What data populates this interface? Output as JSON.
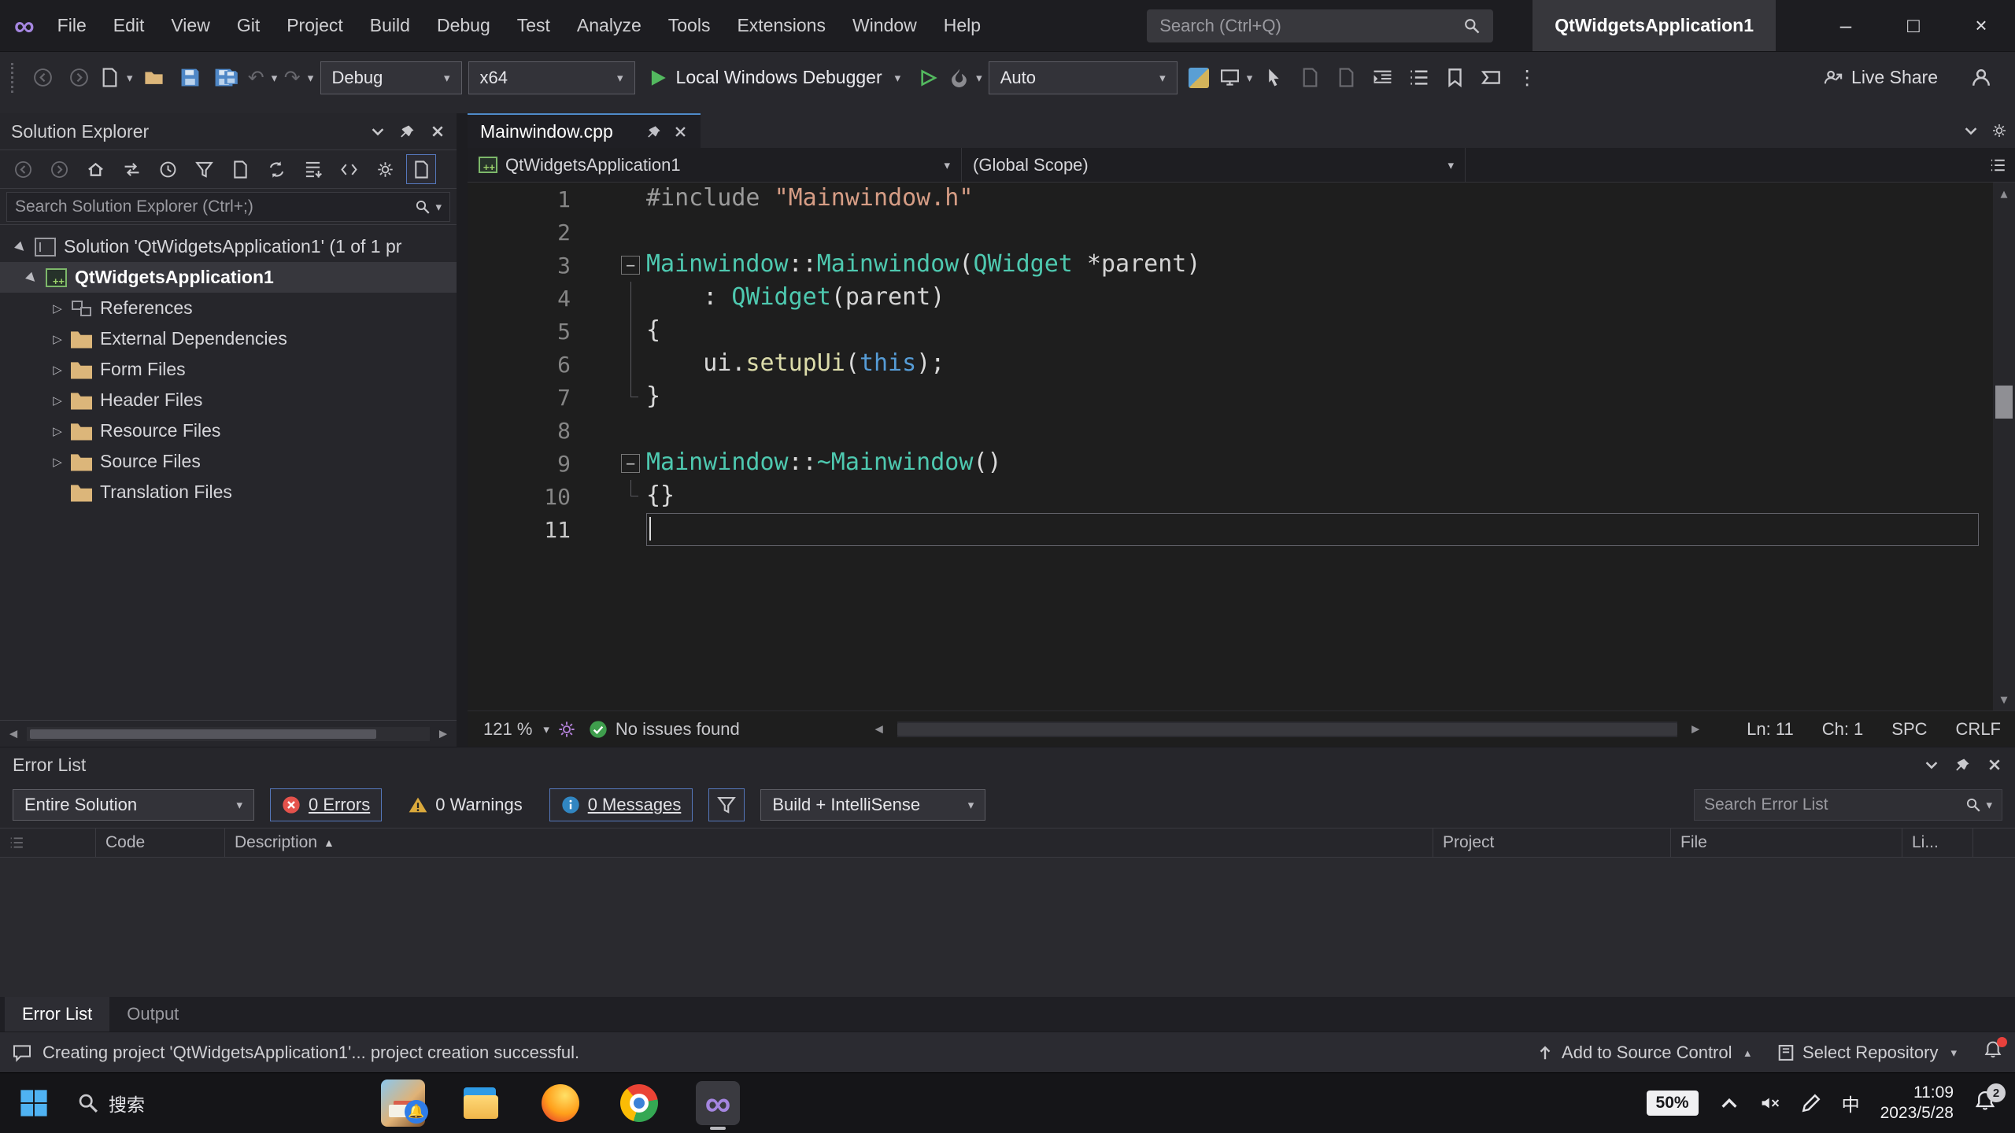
{
  "titlebar": {
    "menus": [
      "File",
      "Edit",
      "View",
      "Git",
      "Project",
      "Build",
      "Debug",
      "Test",
      "Analyze",
      "Tools",
      "Extensions",
      "Window",
      "Help"
    ],
    "search_placeholder": "Search (Ctrl+Q)",
    "window_title": "QtWidgetsApplication1"
  },
  "toolbar": {
    "configuration": "Debug",
    "platform": "x64",
    "run_label": "Local Windows Debugger",
    "attach_label": "Auto",
    "live_share_label": "Live Share"
  },
  "solution_explorer": {
    "title": "Solution Explorer",
    "search_placeholder": "Search Solution Explorer (Ctrl+;)",
    "tree": [
      {
        "label": "Solution 'QtWidgetsApplication1' (1 of 1 pr",
        "icon": "solution",
        "indent": 0,
        "arrow": "expanded",
        "selected": false
      },
      {
        "label": "QtWidgetsApplication1",
        "icon": "project",
        "indent": 1,
        "arrow": "expanded",
        "selected": true
      },
      {
        "label": "References",
        "icon": "references",
        "indent": 2,
        "arrow": "collapsed",
        "selected": false
      },
      {
        "label": "External Dependencies",
        "icon": "folder",
        "indent": 2,
        "arrow": "collapsed",
        "selected": false
      },
      {
        "label": "Form Files",
        "icon": "folder",
        "indent": 2,
        "arrow": "collapsed",
        "selected": false
      },
      {
        "label": "Header Files",
        "icon": "folder",
        "indent": 2,
        "arrow": "collapsed",
        "selected": false
      },
      {
        "label": "Resource Files",
        "icon": "folder",
        "indent": 2,
        "arrow": "collapsed",
        "selected": false
      },
      {
        "label": "Source Files",
        "icon": "folder",
        "indent": 2,
        "arrow": "collapsed",
        "selected": false
      },
      {
        "label": "Translation Files",
        "icon": "folder",
        "indent": 2,
        "arrow": "none",
        "selected": false
      }
    ]
  },
  "editor": {
    "tab_title": "Mainwindow.cpp",
    "breadcrumb_project": "QtWidgetsApplication1",
    "breadcrumb_scope": "(Global Scope)",
    "code": {
      "lines": [
        {
          "n": 1,
          "tokens": [
            {
              "t": "#include ",
              "c": "pp"
            },
            {
              "t": "\"Mainwindow.h\"",
              "c": "str"
            }
          ]
        },
        {
          "n": 2,
          "tokens": []
        },
        {
          "n": 3,
          "fold": "box",
          "tokens": [
            {
              "t": "Mainwindow",
              "c": "type"
            },
            {
              "t": "::",
              "c": "pun"
            },
            {
              "t": "Mainwindow",
              "c": "type"
            },
            {
              "t": "(",
              "c": "pun"
            },
            {
              "t": "QWidget",
              "c": "type"
            },
            {
              "t": " *",
              "c": "pun"
            },
            {
              "t": "parent",
              "c": "param"
            },
            {
              "t": ")",
              "c": "pun"
            }
          ]
        },
        {
          "n": 4,
          "fold": "line",
          "tokens": [
            {
              "t": "    : ",
              "c": "pun"
            },
            {
              "t": "QWidget",
              "c": "type"
            },
            {
              "t": "(",
              "c": "pun"
            },
            {
              "t": "parent",
              "c": "param"
            },
            {
              "t": ")",
              "c": "pun"
            }
          ]
        },
        {
          "n": 5,
          "fold": "line",
          "tokens": [
            {
              "t": "{",
              "c": "pun"
            }
          ]
        },
        {
          "n": 6,
          "fold": "line",
          "tokens": [
            {
              "t": "    ",
              "c": "pun"
            },
            {
              "t": "ui",
              "c": "id"
            },
            {
              "t": ".",
              "c": "pun"
            },
            {
              "t": "setupUi",
              "c": "fn"
            },
            {
              "t": "(",
              "c": "pun"
            },
            {
              "t": "this",
              "c": "kw"
            },
            {
              "t": ");",
              "c": "pun"
            }
          ]
        },
        {
          "n": 7,
          "fold": "corner",
          "tokens": [
            {
              "t": "}",
              "c": "pun"
            }
          ]
        },
        {
          "n": 8,
          "tokens": []
        },
        {
          "n": 9,
          "fold": "box",
          "tokens": [
            {
              "t": "Mainwindow",
              "c": "type"
            },
            {
              "t": "::",
              "c": "pun"
            },
            {
              "t": "~Mainwindow",
              "c": "type"
            },
            {
              "t": "()",
              "c": "pun"
            }
          ]
        },
        {
          "n": 10,
          "fold": "corner",
          "tokens": [
            {
              "t": "{}",
              "c": "pun"
            }
          ]
        },
        {
          "n": 11,
          "current": true,
          "tokens": []
        }
      ]
    },
    "statusbar": {
      "zoom": "121 %",
      "health": "No issues found",
      "line": "Ln: 11",
      "column": "Ch: 1",
      "spaces": "SPC",
      "eol": "CRLF"
    }
  },
  "error_list": {
    "title": "Error List",
    "scope_dropdown": "Entire Solution",
    "errors_label": "0 Errors",
    "warnings_label": "0 Warnings",
    "messages_label": "0 Messages",
    "source_dropdown": "Build + IntelliSense",
    "search_placeholder": "Search Error List",
    "columns": [
      {
        "label": "Code"
      },
      {
        "label": "Description",
        "sort": "asc"
      },
      {
        "label": "Project"
      },
      {
        "label": "File"
      },
      {
        "label": "Li..."
      }
    ],
    "tabs": [
      {
        "label": "Error List",
        "active": true
      },
      {
        "label": "Output",
        "active": false
      }
    ]
  },
  "status_bar": {
    "message": "Creating project 'QtWidgetsApplication1'... project creation successful.",
    "add_to_source_control": "Add to Source Control",
    "select_repository": "Select Repository"
  },
  "taskbar": {
    "search_text": "搜索",
    "apps": [
      {
        "name": "widgets-promo",
        "active": false
      },
      {
        "name": "file-explorer",
        "active": false
      },
      {
        "name": "firefox",
        "active": false
      },
      {
        "name": "chrome",
        "active": false
      },
      {
        "name": "visual-studio",
        "active": true
      }
    ],
    "battery": "50%",
    "ime": "中",
    "time": "11:09",
    "date": "2023/5/28",
    "notification_badge": "2"
  },
  "colors": {
    "accent_blue": "#5577bb",
    "run_green": "#53b95f",
    "error_red": "#e5524c",
    "warning_yellow": "#dba93c",
    "info_blue": "#3186c2",
    "check_green": "#3f9e4d",
    "folder_tan": "#dcb67a",
    "vs_purple": "#a586e0",
    "type_teal": "#4ec9b0",
    "string_orange": "#d69d85",
    "keyword_blue": "#569cd6",
    "function_yellow": "#dcdcaa",
    "preprocessor_gray": "#9b9b9b"
  }
}
